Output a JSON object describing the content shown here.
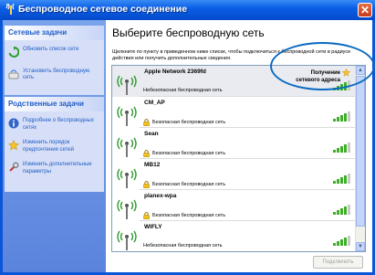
{
  "window": {
    "title": "Беспроводное сетевое соединение"
  },
  "sidebar": {
    "network_tasks": {
      "title": "Сетевые задачи",
      "items": [
        {
          "label": "Обновить список сети",
          "icon": "refresh-icon"
        },
        {
          "label": "Установить беспроводную сеть",
          "icon": "wireless-setup-icon"
        }
      ]
    },
    "related_tasks": {
      "title": "Родственные задачи",
      "items": [
        {
          "label": "Подробнее о беспроводных сетях",
          "icon": "info-icon"
        },
        {
          "label": "Изменить порядок предпочтения сетей",
          "icon": "star-icon"
        },
        {
          "label": "Изменить дополнительные параметры",
          "icon": "settings-icon"
        }
      ]
    }
  },
  "main": {
    "title": "Выберите беспроводную сеть",
    "instructions": "Щелкните по пункту в приведенном ниже списке, чтобы подключиться к беспроводной сети в радиусе действия или получить дополнительные сведения.",
    "connect_button": "Подключить"
  },
  "networks": [
    {
      "ssid": "Apple Network 2369fd",
      "status": "Небезопасная беспроводная сеть",
      "secure": false,
      "connection_state": "Получение\nсетевого адреса",
      "selected": true,
      "signal": 4
    },
    {
      "ssid": "CM_AP",
      "status": "Безопасная беспроводная сеть",
      "secure": true,
      "selected": false,
      "signal": 4
    },
    {
      "ssid": "Sean",
      "status": "Безопасная беспроводная сеть",
      "secure": true,
      "selected": false,
      "signal": 4
    },
    {
      "ssid": "MB12",
      "status": "Безопасная беспроводная сеть",
      "secure": true,
      "selected": false,
      "signal": 4
    },
    {
      "ssid": "planex-wpa",
      "status": "Безопасная беспроводная сеть",
      "secure": true,
      "selected": false,
      "signal": 4
    },
    {
      "ssid": "WIFLY",
      "status": "Небезопасная беспроводная сеть",
      "secure": false,
      "selected": false,
      "signal": 4
    }
  ],
  "colors": {
    "titlebar": "#0a5fe6",
    "sidebar": "#6f97e6",
    "link": "#215dc6",
    "highlight_ring": "#0b6ac0"
  }
}
